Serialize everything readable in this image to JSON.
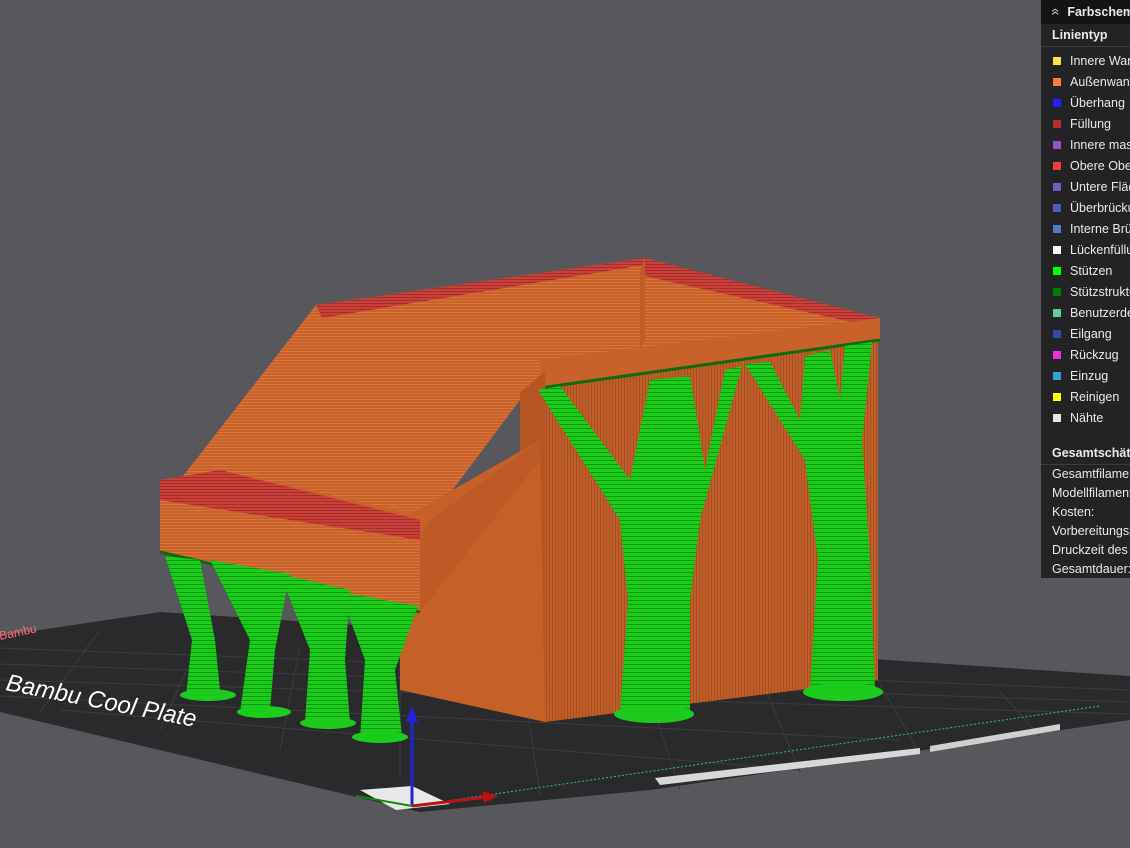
{
  "panel": {
    "title": "Farbschema",
    "section_title": "Linientyp",
    "line_types": [
      {
        "label": "Innere Wand",
        "color": "#ffe24a"
      },
      {
        "label": "Außenwand",
        "color": "#ff7d38"
      },
      {
        "label": "Überhang",
        "color": "#1f1fff"
      },
      {
        "label": "Füllung",
        "color": "#b3302d"
      },
      {
        "label": "Innere massive Füllung",
        "color": "#9654cc"
      },
      {
        "label": "Obere Oberfläche",
        "color": "#f03e3e"
      },
      {
        "label": "Untere Fläche",
        "color": "#6660c4"
      },
      {
        "label": "Überbrückung",
        "color": "#4d5eb3"
      },
      {
        "label": "Interne Brücke",
        "color": "#4d80ba"
      },
      {
        "label": "Lückenfüllung",
        "color": "#ffffff"
      },
      {
        "label": "Stützen",
        "color": "#00ff00"
      },
      {
        "label": "Stützstruktur",
        "color": "#008000"
      },
      {
        "label": "Benutzerdefiniert",
        "color": "#5ed194"
      },
      {
        "label": "Eilgang",
        "color": "#3848a8"
      },
      {
        "label": "Rückzug",
        "color": "#ee2edb"
      },
      {
        "label": "Einzug",
        "color": "#2fa3d4"
      },
      {
        "label": "Reinigen",
        "color": "#ffff00"
      },
      {
        "label": "Nähte",
        "color": "#e6e6e6"
      }
    ],
    "summary_title": "Gesamtschätzung",
    "summary": [
      {
        "label": "Gesamtfilament:"
      },
      {
        "label": "Modellfilament:"
      },
      {
        "label": "Kosten:"
      },
      {
        "label": "Vorbereitungszeit:"
      },
      {
        "label": "Druckzeit des Modells:"
      },
      {
        "label": "Gesamtdauer:"
      }
    ]
  },
  "plate": {
    "label_left": "Bambu Cool Plate",
    "label_small": "Bambu"
  },
  "colors": {
    "background": "#57575c",
    "wall": "#c8622a",
    "top": "#c23a34",
    "support": "#19cc19"
  }
}
